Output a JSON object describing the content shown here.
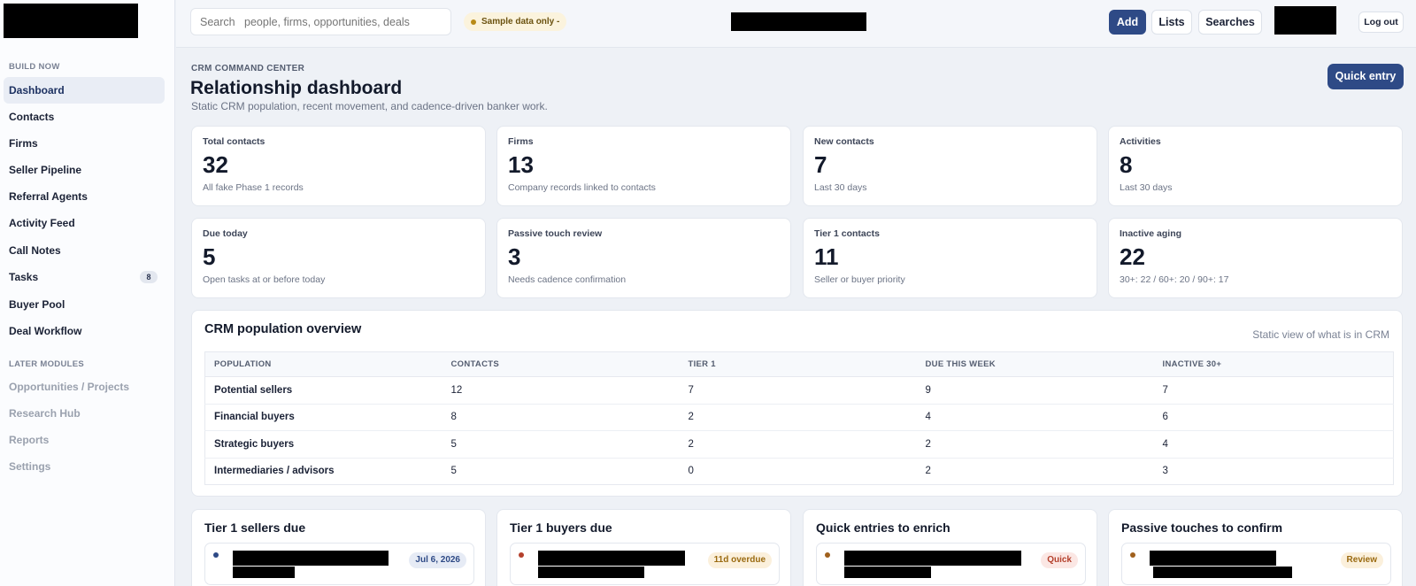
{
  "sidebar": {
    "section_build": "BUILD NOW",
    "section_later": "LATER MODULES",
    "items": [
      {
        "label": "Dashboard"
      },
      {
        "label": "Contacts"
      },
      {
        "label": "Firms"
      },
      {
        "label": "Seller Pipeline"
      },
      {
        "label": "Referral Agents"
      },
      {
        "label": "Activity Feed"
      },
      {
        "label": "Call Notes"
      },
      {
        "label": "Tasks",
        "badge": "8"
      },
      {
        "label": "Buyer Pool"
      },
      {
        "label": "Deal Workflow"
      }
    ],
    "later_items": [
      {
        "label": "Opportunities / Projects"
      },
      {
        "label": "Research Hub"
      },
      {
        "label": "Reports"
      },
      {
        "label": "Settings"
      }
    ]
  },
  "topbar": {
    "search_placeholder": "Search   people, firms, opportunities, deals",
    "sample_label": "Sample data only -",
    "add_label": "Add",
    "lists_label": "Lists",
    "searches_label": "Searches",
    "logout_label": "Log out"
  },
  "header": {
    "eyebrow": "CRM COMMAND CENTER",
    "title": "Relationship dashboard",
    "subtitle": "Static CRM population, recent movement, and cadence-driven banker work.",
    "quick_entry_label": "Quick entry"
  },
  "stats": [
    {
      "label": "Total contacts",
      "value": "32",
      "note": "All fake Phase 1 records"
    },
    {
      "label": "Firms",
      "value": "13",
      "note": "Company records linked to contacts"
    },
    {
      "label": "New contacts",
      "value": "7",
      "note": "Last 30 days"
    },
    {
      "label": "Activities",
      "value": "8",
      "note": "Last 30 days"
    },
    {
      "label": "Due today",
      "value": "5",
      "note": "Open tasks at or before today"
    },
    {
      "label": "Passive touch review",
      "value": "3",
      "note": "Needs cadence confirmation"
    },
    {
      "label": "Tier 1 contacts",
      "value": "11",
      "note": "Seller or buyer priority"
    },
    {
      "label": "Inactive aging",
      "value": "22",
      "note": "30+: 22 / 60+: 20 / 90+: 17"
    }
  ],
  "population": {
    "title": "CRM population overview",
    "right_note": "Static view of what is in CRM",
    "columns": [
      "POPULATION",
      "CONTACTS",
      "TIER 1",
      "DUE THIS WEEK",
      "INACTIVE 30+"
    ],
    "rows": [
      [
        "Potential sellers",
        "12",
        "7",
        "9",
        "7"
      ],
      [
        "Financial buyers",
        "8",
        "2",
        "4",
        "6"
      ],
      [
        "Strategic buyers",
        "5",
        "2",
        "2",
        "4"
      ],
      [
        "Intermediaries / advisors",
        "5",
        "0",
        "2",
        "3"
      ]
    ]
  },
  "bottom_cards": [
    {
      "title": "Tier 1 sellers due",
      "tag": "Jul 6, 2026",
      "bullet_color": "#2e4a86",
      "tag_bg": "#e6ebf5",
      "tag_color": "#2e4a86"
    },
    {
      "title": "Tier 1 buyers due",
      "tag": "11d overdue",
      "bullet_color": "#b4402c",
      "tag_bg": "#fbf0dc",
      "tag_color": "#9a6a10"
    },
    {
      "title": "Quick entries to enrich",
      "tag": "Quick",
      "bullet_color": "#a0601d",
      "tag_bg": "#fbe7e4",
      "tag_color": "#b4402c"
    },
    {
      "title": "Passive touches to confirm",
      "tag": "Review",
      "bullet_color": "#a0601d",
      "tag_bg": "#fbf0dc",
      "tag_color": "#9a6a10"
    }
  ]
}
